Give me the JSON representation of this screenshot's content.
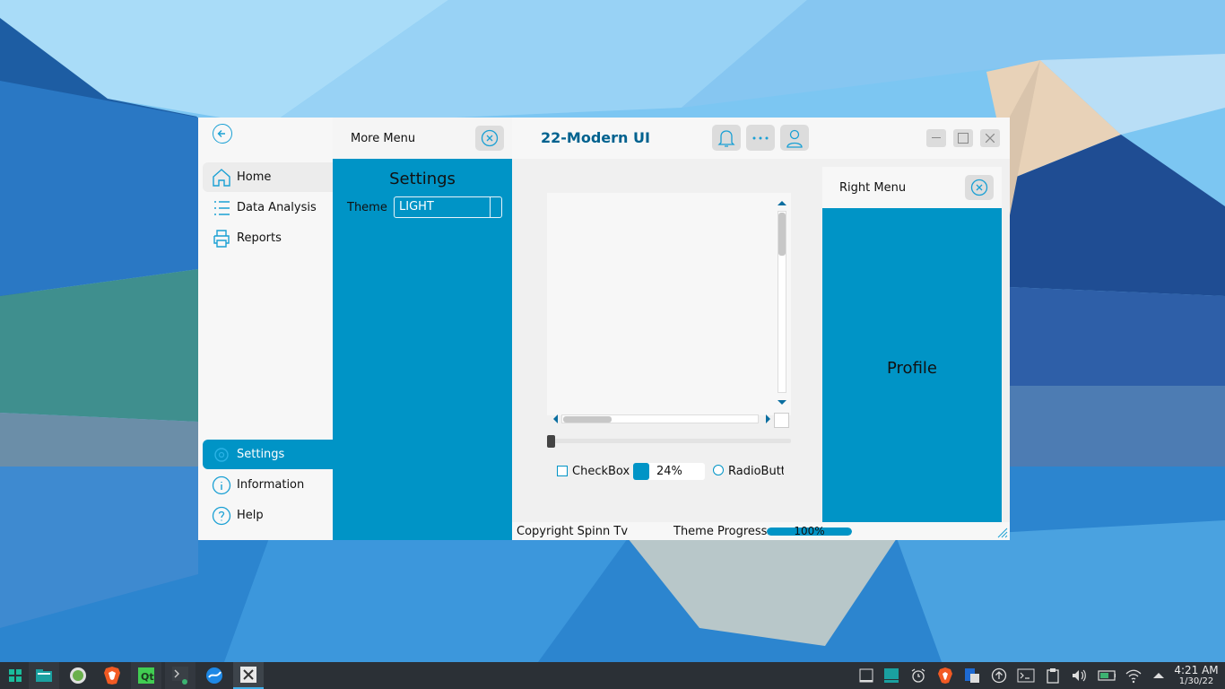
{
  "window": {
    "title": "22-Modern UI",
    "controls": [
      "minimize",
      "maximize",
      "close"
    ]
  },
  "left_menu": {
    "items": [
      {
        "label": "Home",
        "icon": "home-icon"
      },
      {
        "label": "Data Analysis",
        "icon": "list-icon"
      },
      {
        "label": "Reports",
        "icon": "printer-icon"
      }
    ],
    "bottom_items": [
      {
        "label": "Settings",
        "icon": "gear-icon"
      },
      {
        "label": "Information",
        "icon": "info-icon"
      },
      {
        "label": "Help",
        "icon": "help-icon"
      }
    ]
  },
  "more_menu": {
    "title": "More Menu",
    "settings_title": "Settings",
    "theme_label": "Theme",
    "theme_value": "LIGHT"
  },
  "content": {
    "checkbox_label": "CheckBox",
    "spin_value": "24%",
    "radio_label": "RadioButton"
  },
  "right_menu": {
    "title": "Right Menu",
    "profile": "Profile"
  },
  "footer": {
    "copyright": "Copyright Spinn Tv",
    "progress_label": "Theme Progress",
    "progress_text": "100%",
    "progress_value": 1.0
  },
  "taskbar": {
    "time": "4:21 AM",
    "date": "1/30/22"
  },
  "colors": {
    "accent": "#0094c6",
    "title": "#00628f",
    "taskbar": "#2b3036"
  }
}
